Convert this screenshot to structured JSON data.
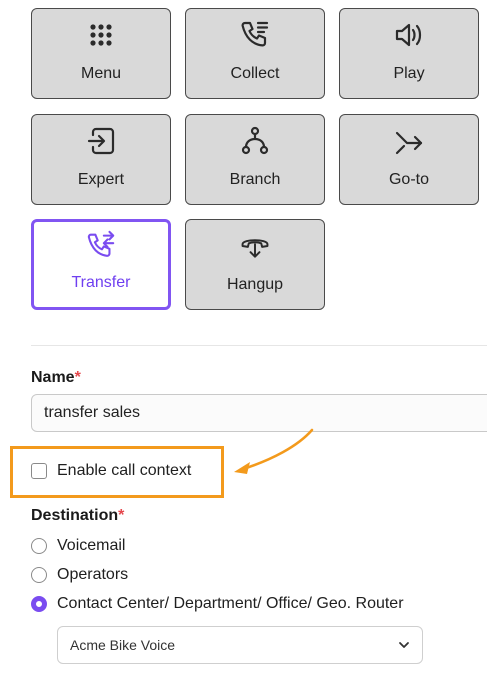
{
  "tiles": [
    {
      "label": "Menu",
      "icon": "grid-dots-icon"
    },
    {
      "label": "Collect",
      "icon": "phone-list-icon"
    },
    {
      "label": "Play",
      "icon": "speaker-icon"
    },
    {
      "label": "Expert",
      "icon": "login-box-icon"
    },
    {
      "label": "Branch",
      "icon": "branch-icon"
    },
    {
      "label": "Go-to",
      "icon": "goto-arrow-icon"
    },
    {
      "label": "Transfer",
      "icon": "phone-transfer-icon"
    },
    {
      "label": "Hangup",
      "icon": "hangup-icon"
    }
  ],
  "selected_tile": "Transfer",
  "name_field": {
    "label": "Name",
    "required_mark": "*",
    "value": "transfer sales"
  },
  "call_context": {
    "label": "Enable call context",
    "checked": false
  },
  "destination": {
    "label": "Destination",
    "required_mark": "*",
    "options": [
      {
        "label": "Voicemail",
        "checked": false
      },
      {
        "label": "Operators",
        "checked": false
      },
      {
        "label": "Contact Center/ Department/ Office/ Geo. Router",
        "checked": true
      }
    ],
    "select_value": "Acme Bike Voice"
  },
  "colors": {
    "accent": "#7a4cf0",
    "highlight": "#f39a1c",
    "required": "#e5484d",
    "tile_bg": "#d9d9d9"
  }
}
